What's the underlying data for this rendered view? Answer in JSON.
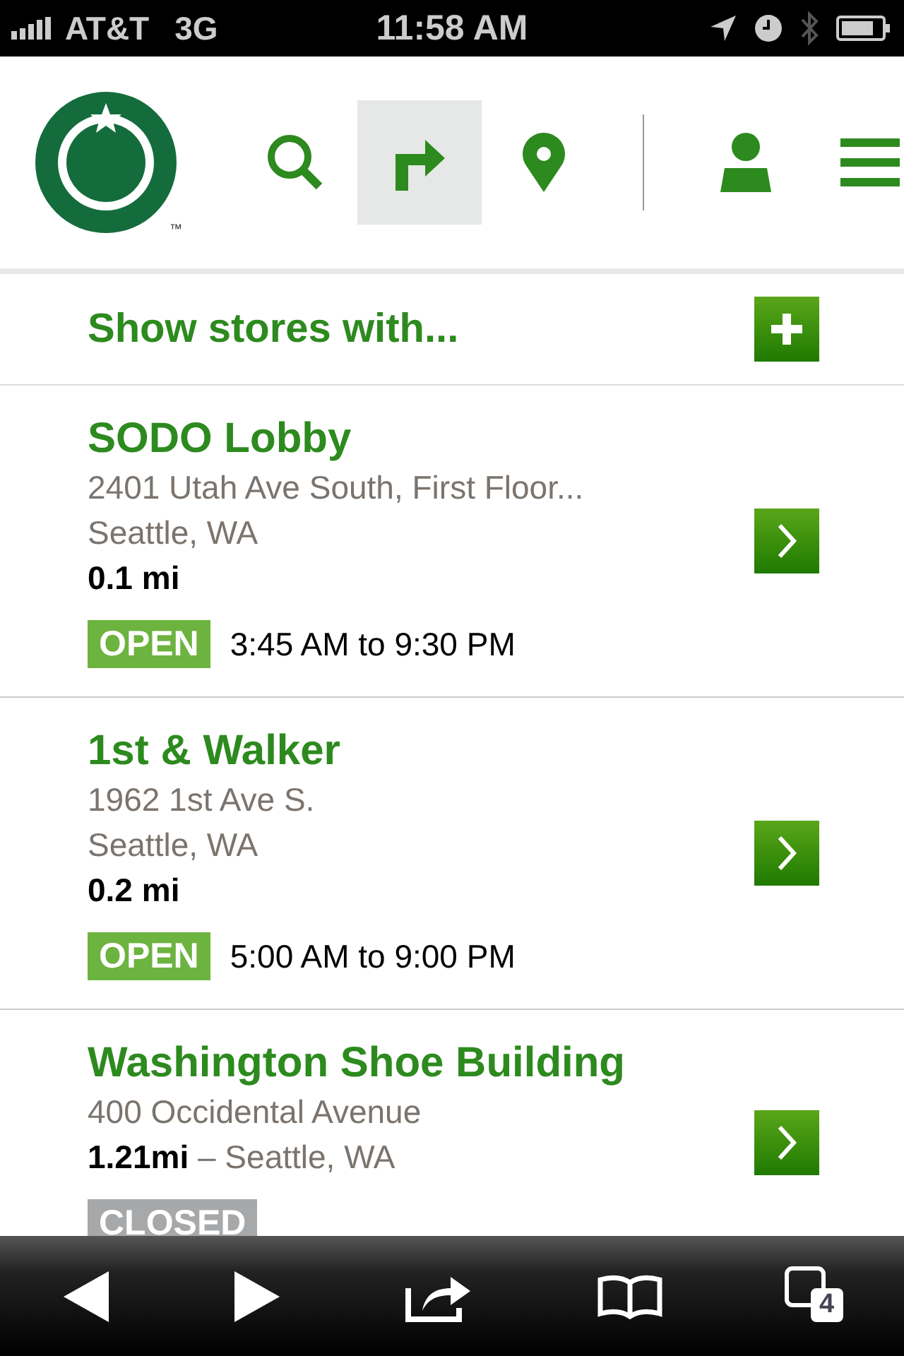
{
  "status_bar": {
    "carrier": "AT&T",
    "network": "3G",
    "time": "11:58 AM"
  },
  "header": {
    "trademark": "™",
    "nav": [
      {
        "kind": "search",
        "selected": false
      },
      {
        "kind": "directions",
        "selected": true
      },
      {
        "kind": "pin",
        "selected": false
      },
      {
        "kind": "account",
        "selected": false
      },
      {
        "kind": "menu",
        "selected": false
      }
    ]
  },
  "filter": {
    "label": "Show stores with..."
  },
  "stores": [
    {
      "name": "SODO Lobby",
      "address": "2401 Utah Ave South, First Floor...",
      "lines": [
        {
          "kind": "city",
          "text": "Seattle, WA"
        },
        {
          "kind": "distance",
          "text": "0.1 mi"
        }
      ],
      "status": "OPEN",
      "open": true,
      "hours": "3:45 AM to 9:30 PM"
    },
    {
      "name": "1st & Walker",
      "address": "1962 1st Ave S.",
      "lines": [
        {
          "kind": "city",
          "text": "Seattle, WA"
        },
        {
          "kind": "distance",
          "text": "0.2 mi"
        }
      ],
      "status": "OPEN",
      "open": true,
      "hours": "5:00 AM to 9:00 PM"
    },
    {
      "name": "Washington Shoe Building",
      "address": "400 Occidental Avenue",
      "lines": [
        {
          "kind": "distance_city",
          "text": "**1.21mi** – Seattle, WA"
        }
      ],
      "status": "CLOSED",
      "open": false
    }
  ],
  "toolbar": {
    "tab_count": "4"
  }
}
